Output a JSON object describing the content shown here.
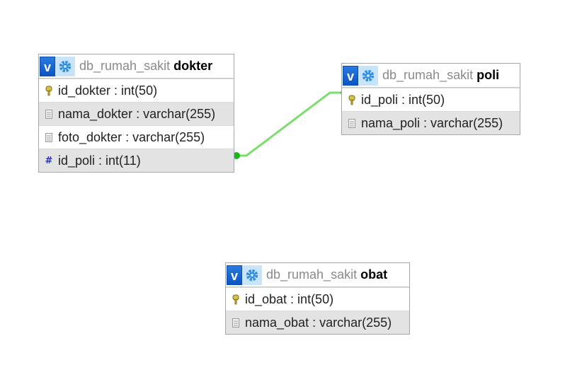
{
  "tables": {
    "dokter": {
      "db_name": "db_rumah_sakit",
      "table_name": "dokter",
      "columns": [
        {
          "text": "id_dokter : int(50)",
          "kind": "key-icon"
        },
        {
          "text": "nama_dokter : varchar(255)",
          "kind": "text-field-icon"
        },
        {
          "text": "foto_dokter : varchar(255)",
          "kind": "text-field-icon"
        },
        {
          "text": "id_poli : int(11)",
          "kind": "numeric-hash-icon"
        }
      ]
    },
    "poli": {
      "db_name": "db_rumah_sakit",
      "table_name": "poli",
      "columns": [
        {
          "text": "id_poli : int(50)",
          "kind": "key-icon"
        },
        {
          "text": "nama_poli : varchar(255)",
          "kind": "text-field-icon"
        }
      ]
    },
    "obat": {
      "db_name": "db_rumah_sakit",
      "table_name": "obat",
      "columns": [
        {
          "text": "id_obat : int(50)",
          "kind": "key-icon"
        },
        {
          "text": "nama_obat : varchar(255)",
          "kind": "text-field-icon"
        }
      ]
    }
  },
  "header_button_label": "v",
  "colors": {
    "relation_line": "#7ddc6f",
    "relation_endpoint": "#18b818",
    "header_blue": "#0a54c4",
    "gear_bg": "#c9e3fb",
    "row_alt": "#e3e3e3"
  }
}
